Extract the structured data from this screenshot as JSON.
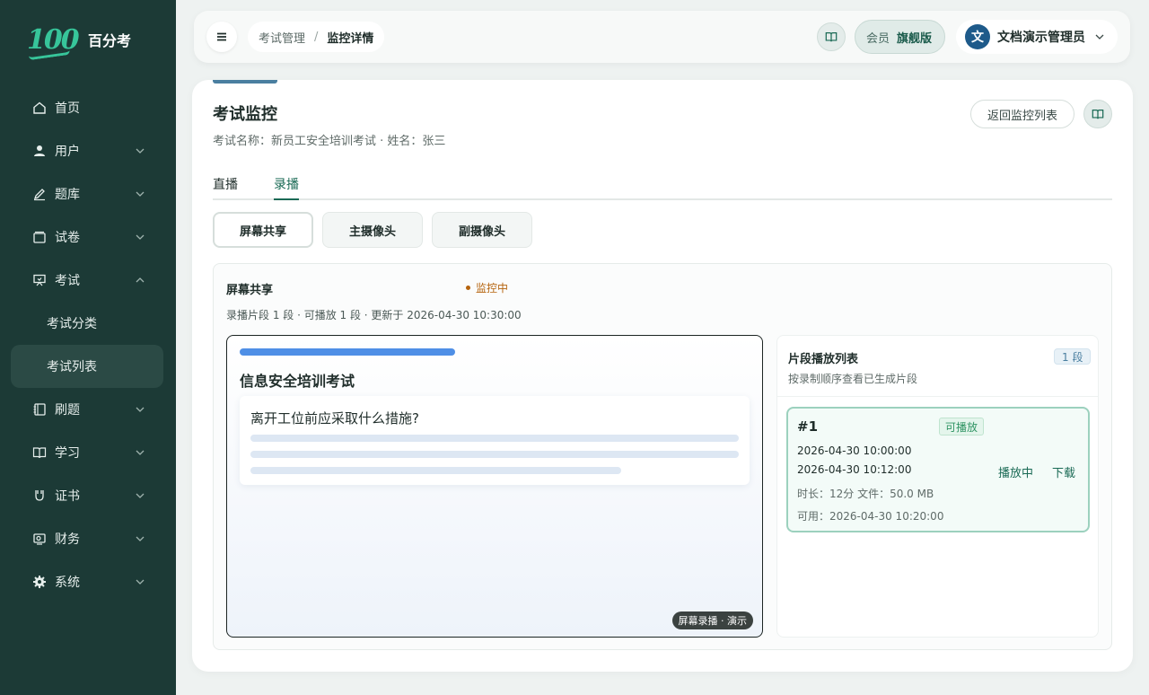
{
  "brand": {
    "logo": "100",
    "name": "百分考"
  },
  "sidebar": {
    "items": [
      {
        "label": "首页",
        "icon": "home-icon"
      },
      {
        "label": "用户",
        "icon": "user-icon"
      },
      {
        "label": "题库",
        "icon": "pen-icon"
      },
      {
        "label": "试卷",
        "icon": "paper-icon"
      },
      {
        "label": "考试",
        "icon": "presentation-icon"
      },
      {
        "label": "刷题",
        "icon": "notebook-icon"
      },
      {
        "label": "学习",
        "icon": "book-open-icon"
      },
      {
        "label": "证书",
        "icon": "certificate-icon"
      },
      {
        "label": "财务",
        "icon": "finance-icon"
      },
      {
        "label": "系统",
        "icon": "gear-icon"
      }
    ],
    "exam_sub": [
      {
        "label": "考试分类"
      },
      {
        "label": "考试列表"
      }
    ]
  },
  "header": {
    "breadcrumb": [
      "考试管理",
      "/",
      "监控详情"
    ],
    "member_label": "会员",
    "member_tier": "旗舰版",
    "avatar_letter": "文",
    "user_name": "文档演示管理员"
  },
  "page": {
    "title": "考试监控",
    "subtitle": "考试名称：新员工安全培训考试 · 姓名：张三",
    "back_label": "返回监控列表",
    "tabs": [
      "直播",
      "录播"
    ],
    "segments": [
      "屏幕共享",
      "主摄像头",
      "副摄像头"
    ]
  },
  "panel": {
    "title": "屏幕共享",
    "status": "监控中",
    "meta": "录播片段 1 段 · 可播放 1 段 · 更新于 2026-04-30 10:30:00",
    "preview": {
      "title": "信息安全培训考试",
      "question": "离开工位前应采取什么措施?",
      "tag": "屏幕录播 · 演示"
    },
    "clips": {
      "title": "片段播放列表",
      "desc": "按录制顺序查看已生成片段",
      "count": "1 段",
      "items": [
        {
          "no": "#1",
          "state": "可播放",
          "start": "2026-04-30 10:00:00",
          "end": "2026-04-30 10:12:00",
          "info": "时长：12分 文件：50.0 MB",
          "available": "可用：2026-04-30 10:20:00",
          "play": "播放中",
          "download": "下载"
        }
      ]
    }
  },
  "colors": {
    "sidebar": "#1c3a36",
    "accent": "#1a6a55",
    "warning": "#b5630d",
    "preview_bar": "#4f8fe6"
  }
}
